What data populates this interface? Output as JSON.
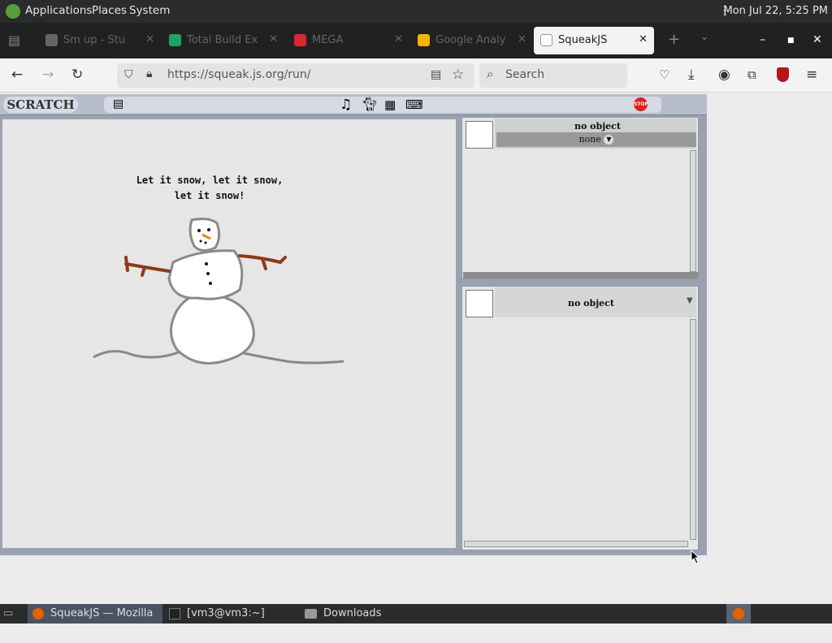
{
  "topbar": {
    "applications": "Applications",
    "places": "Places",
    "system": "System",
    "clock": "Mon Jul 22,  5:25 PM"
  },
  "tabs": [
    {
      "label": "Sm up - Stu"
    },
    {
      "label": "Total Build Ex"
    },
    {
      "label": "MEGA"
    },
    {
      "label": "Google Analy"
    },
    {
      "label": "SqueakJS"
    }
  ],
  "tab_close": "✕",
  "new_tab": "+",
  "nav": {
    "url": "https://squeak.js.org/run/",
    "search_placeholder": "Search"
  },
  "scratch": {
    "brand": "SCRATCH",
    "stop": "STOP",
    "speech_line1": "Let it snow, let it snow,",
    "speech_line2": "let it snow!",
    "panel1": {
      "title": "no object",
      "dropdown": "none"
    },
    "panel2": {
      "title": "no object"
    }
  },
  "taskbar": {
    "firefox": "SqueakJS — Mozilla ...",
    "terminal": "[vm3@vm3:~]",
    "downloads": "Downloads"
  }
}
